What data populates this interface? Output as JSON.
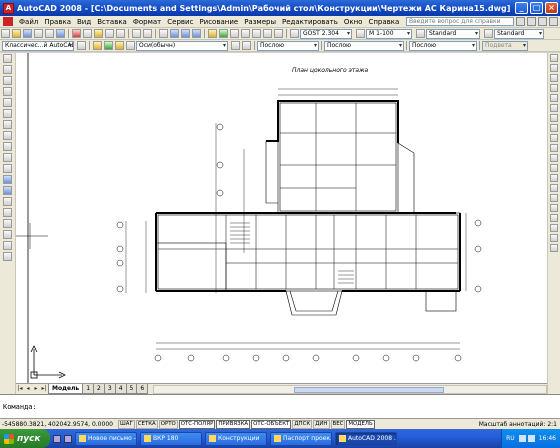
{
  "window": {
    "title": "AutoCAD 2008 - [C:\\Documents and Settings\\Admin\\Рабочий стол\\Конструкции\\Чертежи АС Карина15.dwg]",
    "app_icon": "autocad-logo-icon",
    "controls": [
      "_",
      "□",
      "×"
    ]
  },
  "menu": {
    "items": [
      "Файл",
      "Правка",
      "Вид",
      "Вставка",
      "Формат",
      "Сервис",
      "Рисование",
      "Размеры",
      "Редактировать",
      "Окно",
      "Справка"
    ],
    "help_search_placeholder": "Введите вопрос для справки"
  },
  "toolbar_standard": {
    "dim_style": "GOST 2.304",
    "scale": "М 1-100",
    "text_style": "Standard",
    "table_style": "Standard"
  },
  "toolbar_layers": {
    "workspace": "Классичес...й AutoCAD",
    "layer": "Оси(обычн)",
    "color": "Послою",
    "linetype": "Послою",
    "lineweight": "Послою",
    "plotstyle": "Подвета"
  },
  "drawing": {
    "caption": "План цокольного этажа",
    "colors": {
      "background": "#ffffff",
      "lines": "#000000"
    }
  },
  "layout_tabs": {
    "nav": [
      "|◂",
      "◂",
      "▸",
      "▸|"
    ],
    "tabs": [
      "Модель",
      "1",
      "2",
      "3",
      "4",
      "5",
      "6"
    ],
    "active": "Модель"
  },
  "command": {
    "line1": "",
    "prompt": "Команда:"
  },
  "status": {
    "coords": "-545880.3821, 402042.9574, 0.0000",
    "buttons": [
      {
        "label": "ШАГ",
        "on": false
      },
      {
        "label": "СЕТКА",
        "on": false
      },
      {
        "label": "ОРТО",
        "on": false
      },
      {
        "label": "ОТС-ПОЛЯР",
        "on": true
      },
      {
        "label": "ПРИВЯЗКА",
        "on": true
      },
      {
        "label": "ОТС-ОБЪЕКТ",
        "on": true
      },
      {
        "label": "ДПСК",
        "on": false
      },
      {
        "label": "ДИН",
        "on": false
      },
      {
        "label": "ВЕС",
        "on": false
      },
      {
        "label": "МОДЕЛЬ",
        "on": true
      }
    ],
    "annotation_scale_label": "Масштаб аннотаций:",
    "annotation_scale_value": "2:1"
  },
  "taskbar": {
    "start_label": "пуск",
    "tasks": [
      {
        "label": "Новое письмо -...",
        "active": false
      },
      {
        "label": "ВКР 180",
        "active": false
      },
      {
        "label": "Конструкции",
        "active": false
      },
      {
        "label": "Паспорт проек...",
        "active": false
      },
      {
        "label": "AutoCAD 2008 ...",
        "active": true
      }
    ],
    "lang": "RU",
    "clock": "16:46"
  }
}
